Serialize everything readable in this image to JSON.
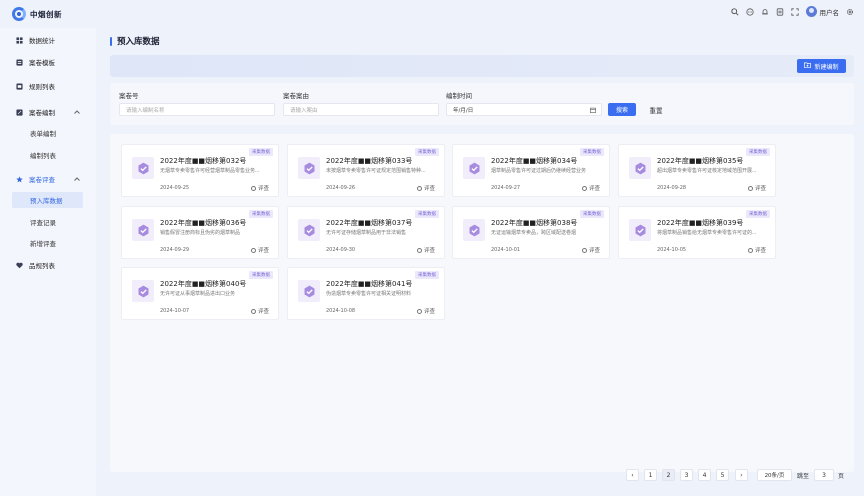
{
  "app": {
    "logo_text": "中烟创新",
    "username": "用户名"
  },
  "topbar": {
    "icons": [
      "search-icon",
      "message-icon",
      "bell-icon",
      "doc-icon",
      "fullscreen-icon",
      "gear-icon"
    ]
  },
  "sidebar": {
    "items": [
      {
        "label": "数据统计",
        "icon": "grid-icon"
      },
      {
        "label": "案卷模板",
        "icon": "template-icon"
      },
      {
        "label": "规则列表",
        "icon": "list-icon"
      },
      {
        "label": "案卷编制",
        "icon": "edit-icon",
        "expanded": true,
        "children": [
          {
            "label": "表单编制"
          },
          {
            "label": "编制列表"
          }
        ]
      },
      {
        "label": "案卷评查",
        "icon": "star-icon",
        "expanded": true,
        "children": [
          {
            "label": "预入库数据",
            "active": true
          },
          {
            "label": "评查记录"
          },
          {
            "label": "新增评查"
          }
        ]
      },
      {
        "label": "品规列表",
        "icon": "heart-icon"
      }
    ]
  },
  "main": {
    "title": "预入库数据",
    "new_button": "新建编制",
    "filters": {
      "case_no_label": "案卷号",
      "case_no_placeholder": "请输入编制名称",
      "case_reason_label": "案卷案由",
      "case_reason_placeholder": "请输入案由",
      "date_label": "编制时间",
      "date_placeholder": "年/月/日",
      "search_button": "搜索",
      "reset_button": "重置"
    },
    "cards": [
      {
        "tag": "采集数据",
        "name": "2022年度■■烟移第032号",
        "desc": "无烟草专卖零售许可经营烟草制品零售业务...",
        "date": "2024-09-25",
        "review": "评查"
      },
      {
        "tag": "采集数据",
        "name": "2022年度■■烟移第033号",
        "desc": "未按烟草专卖零售许可证规定范围销售特种...",
        "date": "2024-09-26",
        "review": "评查"
      },
      {
        "tag": "采集数据",
        "name": "2022年度■■烟移第034号",
        "desc": "烟草制品零售许可证过期后仍继续经营业务",
        "date": "2024-09-27",
        "review": "评查"
      },
      {
        "tag": "采集数据",
        "name": "2022年度■■烟移第035号",
        "desc": "超出烟草专卖零售许可证核定地域范围开展...",
        "date": "2024-09-28",
        "review": "评查"
      },
      {
        "tag": "采集数据",
        "name": "2022年度■■烟移第036号",
        "desc": "销售假冒注册商标且伪劣的烟草制品",
        "date": "2024-09-29",
        "review": "评查"
      },
      {
        "tag": "采集数据",
        "name": "2022年度■■烟移第037号",
        "desc": "无许可证存储烟草制品用于非法销售",
        "date": "2024-09-30",
        "review": "评查"
      },
      {
        "tag": "采集数据",
        "name": "2022年度■■烟移第038号",
        "desc": "无证运输烟草专卖品，跨区域配送卷烟",
        "date": "2024-10-01",
        "review": "评查"
      },
      {
        "tag": "采集数据",
        "name": "2022年度■■烟移第039号",
        "desc": "将烟草制品销售给无烟草专卖零售许可证的...",
        "date": "2024-10-05",
        "review": "评查"
      },
      {
        "tag": "采集数据",
        "name": "2022年度■■烟移第040号",
        "desc": "无许可证从事烟草制品进出口业务",
        "date": "2024-10-07",
        "review": "评查"
      },
      {
        "tag": "采集数据",
        "name": "2022年度■■烟移第041号",
        "desc": "伪造烟草专卖零售许可证相关证明材料",
        "date": "2024-10-08",
        "review": "评查"
      }
    ]
  },
  "pagination": {
    "prev": "‹",
    "next": "›",
    "pages": [
      "1",
      "2",
      "3",
      "4",
      "5"
    ],
    "current": "2",
    "page_size": "20条/页",
    "jump_label": "跳至",
    "jump_value": "3",
    "jump_suffix": "页"
  },
  "colors": {
    "primary": "#3a6df0",
    "tag_bg": "#ece8fb",
    "tag_text": "#7b6ad8",
    "badge": "#a78be0"
  }
}
